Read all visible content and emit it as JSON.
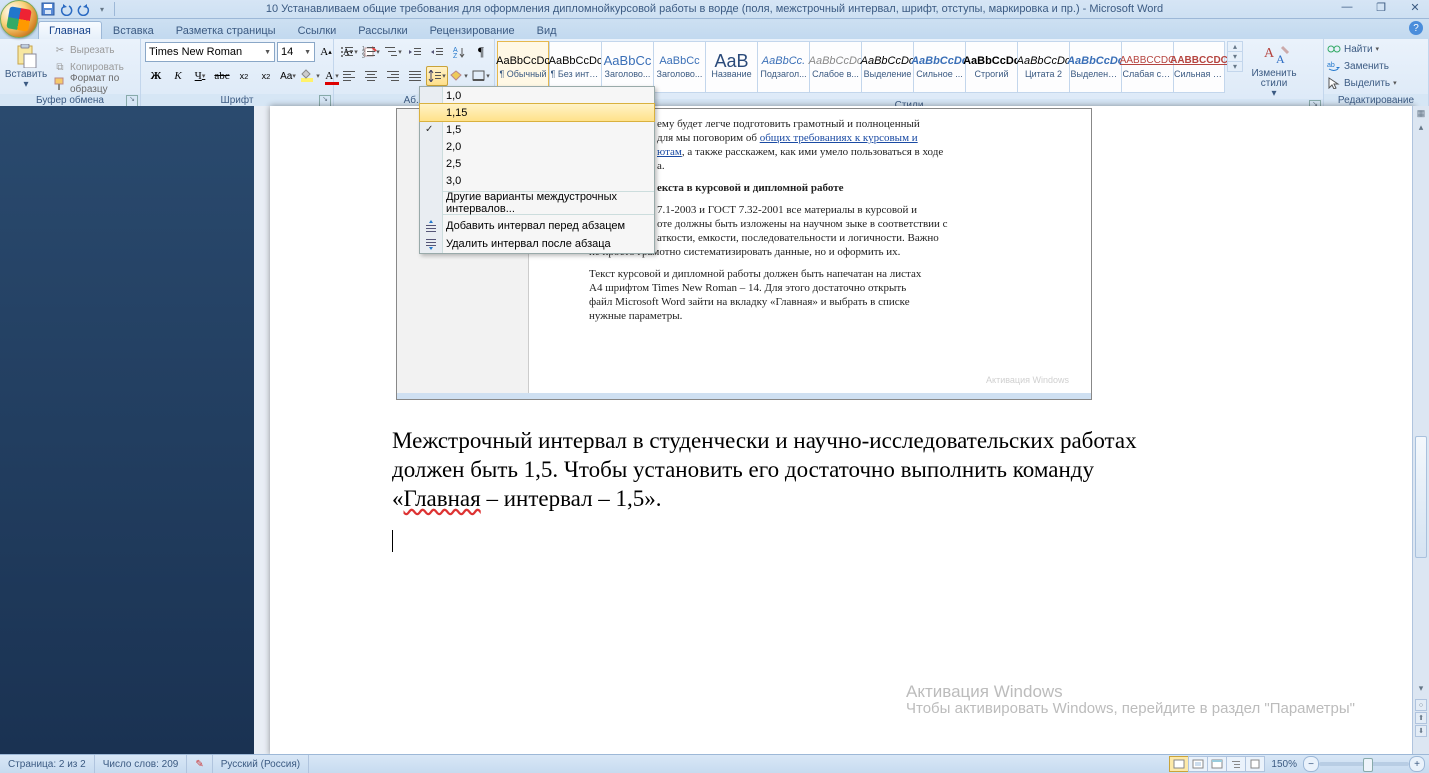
{
  "title": "10 Устанавливаем общие требования для оформления дипломнойкурсовой работы в ворде (поля, межстрочный интервал, шрифт, отступы, маркировка и пр.) - Microsoft Word",
  "tabs": {
    "t0": "Главная",
    "t1": "Вставка",
    "t2": "Разметка страницы",
    "t3": "Ссылки",
    "t4": "Рассылки",
    "t5": "Рецензирование",
    "t6": "Вид"
  },
  "clipboard": {
    "paste": "Вставить",
    "cut": "Вырезать",
    "copy": "Копировать",
    "painter": "Формат по образцу",
    "label": "Буфер обмена"
  },
  "font": {
    "name": "Times New Roman",
    "size": "14",
    "label": "Шрифт"
  },
  "para": {
    "label": "Аб..."
  },
  "lineSpacing": {
    "v0": "1,0",
    "v1": "1,15",
    "v2": "1,5",
    "v3": "2,0",
    "v4": "2,5",
    "v5": "3,0",
    "more": "Другие варианты междустрочных интервалов...",
    "addBefore": "Добавить интервал перед абзацем",
    "removeAfter": "Удалить интервал после абзаца"
  },
  "styles": {
    "label": "Стили",
    "change": "Изменить стили",
    "s0": {
      "p": "AaBbCcDc",
      "n": "¶ Обычный"
    },
    "s1": {
      "p": "AaBbCcDc",
      "n": "¶ Без инте..."
    },
    "s2": {
      "p": "AaBbCc",
      "n": "Заголово..."
    },
    "s3": {
      "p": "AaBbCc",
      "n": "Заголово..."
    },
    "s4": {
      "p": "AaB",
      "n": "Название"
    },
    "s5": {
      "p": "AaBbCc.",
      "n": "Подзагол..."
    },
    "s6": {
      "p": "AaBbCcDc",
      "n": "Слабое в..."
    },
    "s7": {
      "p": "AaBbCcDc",
      "n": "Выделение"
    },
    "s8": {
      "p": "AaBbCcDc",
      "n": "Сильное ..."
    },
    "s9": {
      "p": "AaBbCcDc",
      "n": "Строгий"
    },
    "s10": {
      "p": "AaBbCcDc",
      "n": "Цитата 2"
    },
    "s11": {
      "p": "AaBbCcDc",
      "n": "Выделенн..."
    },
    "s12": {
      "p": "AABBCCDC",
      "n": "Слабая сс..."
    },
    "s13": {
      "p": "AABBCCDC",
      "n": "Сильная с..."
    }
  },
  "editing": {
    "find": "Найти",
    "replace": "Заменить",
    "select": "Выделить",
    "label": "Редактирование"
  },
  "inner": {
    "l1a": "ему будет легче подготовить грамотный и полноценный",
    "l2a": "для мы поговорим об ",
    "l2link": "общих требованиях к курсовым и",
    "l3link": "ютам",
    "l3b": ", а также расскажем, как ими умело пользоваться в ходе",
    "l4": "а.",
    "h": "екста в курсовой и дипломной работе",
    "l5": "7.1-2003 и ГОСТ 7.32-2001 все материалы в курсовой и",
    "l6": "оте должны быть изложены на научном зыке в соответствии с",
    "l7": "аткости, емкости, последовательности и логичности. Важно",
    "l8": "не просто грамотно систематизировать данные, но и оформить их.",
    "p2": "Текст курсовой и дипломной работы должен быть напечатан на листах А4 шрифтом Times New Roman – 14. Для этого достаточно открыть файл Microsoft Word зайти на вкладку «Главная» и выбрать в списке нужные параметры.",
    "w1": "Активация Windows",
    "w2": ""
  },
  "doc": {
    "line1a": "Межстрочный интервал в студенчески и научно-исследовательских работах",
    "line2": "должен быть 1,5. Чтобы установить его достаточно выполнить команду",
    "line3a": "«",
    "line3u": "Главная",
    "line3b": " – интервал – 1,5»."
  },
  "watermark": {
    "t1": "Активация Windows",
    "t2": "Чтобы активировать Windows, перейдите в раздел \"Параметры\""
  },
  "status": {
    "page": "Страница: 2 из 2",
    "words": "Число слов: 209",
    "lang": "Русский (Россия)",
    "zoom": "150%"
  }
}
